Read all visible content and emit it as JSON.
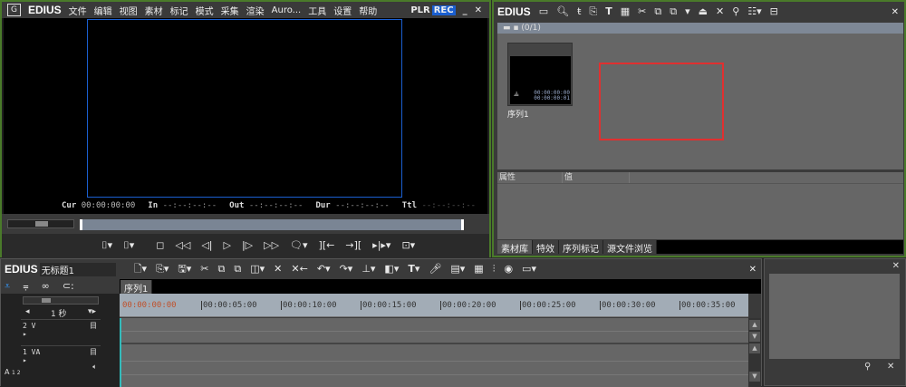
{
  "player": {
    "logo": "EDIUS",
    "menu": [
      "文件",
      "编辑",
      "视图",
      "素材",
      "标记",
      "模式",
      "采集",
      "渲染",
      "Auro...",
      "工具",
      "设置",
      "帮助"
    ],
    "plr": "PLR",
    "rec": "REC",
    "minimize": "_",
    "close": "✕",
    "timecodes": [
      {
        "label": "Cur",
        "value": "00:00:00:00"
      },
      {
        "label": "In",
        "value": "--:--:--:--"
      },
      {
        "label": "Out",
        "value": "--:--:--:--"
      },
      {
        "label": "Dur",
        "value": "--:--:--:--"
      },
      {
        "label": "Ttl",
        "value": "--:--:--:--"
      }
    ],
    "accent": "#1a5fd0"
  },
  "bin": {
    "logo": "EDIUS",
    "toolbar_icons": [
      "folder-icon",
      "search-icon",
      "up-icon",
      "import-icon",
      "title-icon",
      "color-bars-icon",
      "cut-icon",
      "copy-icon",
      "paste-icon",
      "add-to-timeline-icon",
      "insert-icon",
      "delete-icon",
      "properties-icon",
      "view-icon",
      "toolbox-icon"
    ],
    "close": "✕",
    "folder_label": "(0/1)",
    "clip": {
      "name": "序列1",
      "tc_in": "00:00:00:00",
      "tc_out": "00:00:00:01"
    },
    "props_headers": [
      "属性",
      "值"
    ],
    "tabs": [
      "素材库",
      "特效",
      "序列标记",
      "源文件浏览"
    ],
    "highlight_color": "#e03030"
  },
  "timeline": {
    "logo": "EDIUS",
    "project_name": "无标题1",
    "sequence_tab": "序列1",
    "scale": "1 秒",
    "close": "✕",
    "ruler": [
      "00:00:00:00",
      "00:00:05:00",
      "00:00:10:00",
      "00:00:15:00",
      "00:00:20:00",
      "00:00:25:00",
      "00:00:30:00",
      "00:00:35:00"
    ],
    "tracks": [
      {
        "name": "2 V"
      },
      {
        "name": "1 VA"
      }
    ],
    "audio_label": "A",
    "audio_channels": "1 2"
  },
  "side_panel": {
    "close": "✕"
  }
}
